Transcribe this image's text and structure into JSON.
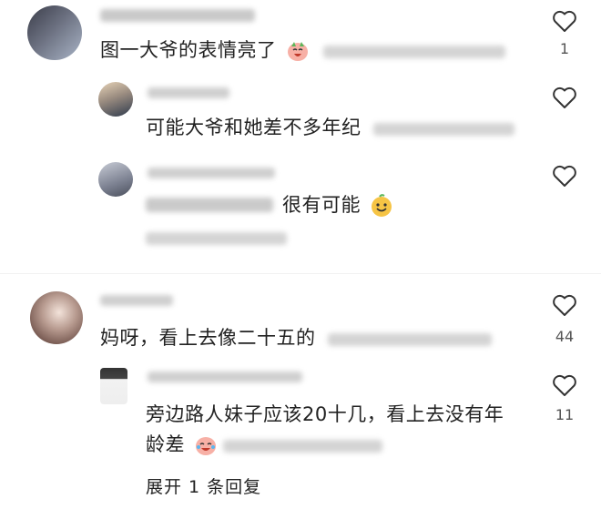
{
  "comments": [
    {
      "text": "图一大爷的表情亮了",
      "like_count": "1",
      "replies": [
        {
          "text": "可能大爷和她差不多年纪"
        },
        {
          "text": "很有可能"
        }
      ]
    },
    {
      "text": "妈呀，看上去像二十五的",
      "like_count": "44",
      "replies": [
        {
          "text_line1": "旁边路人妹子应该20十几，看上去没有年",
          "text_line2": "龄差",
          "like_count": "11"
        }
      ],
      "expand_label": "展开 1 条回复"
    }
  ],
  "colors": {
    "heart_stroke": "#333333",
    "blur_gray": "#c9c9c9"
  },
  "icons": {
    "like": "heart-outline-icon"
  }
}
